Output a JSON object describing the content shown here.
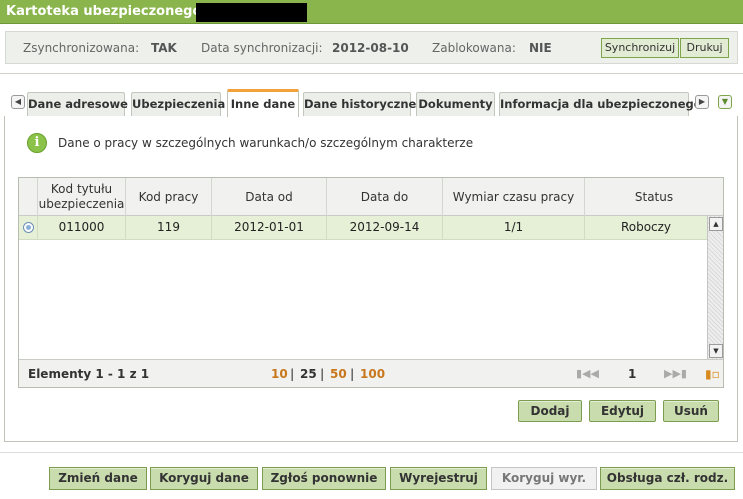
{
  "window": {
    "title": "Kartoteka ubezpieczonego -"
  },
  "sync": {
    "synchronized_label": "Zsynchronizowana:",
    "synchronized_value": "TAK",
    "date_label": "Data synchronizacji:",
    "date_value": "2012-08-10",
    "locked_label": "Zablokowana:",
    "locked_value": "NIE",
    "sync_button": "Synchronizuj",
    "print_button": "Drukuj"
  },
  "tabs": [
    {
      "label": "Dane adresowe"
    },
    {
      "label": "Ubezpieczenia"
    },
    {
      "label": "Inne dane"
    },
    {
      "label": "Dane historyczne"
    },
    {
      "label": "Dokumenty"
    },
    {
      "label": "Informacja dla ubezpieczonego"
    }
  ],
  "active_tab": "Inne dane",
  "info": {
    "text": "Dane o pracy w szczególnych warunkach/o szczególnym charakterze"
  },
  "grid": {
    "columns": [
      "Kod tytułu ubezpieczenia",
      "Kod pracy",
      "Data od",
      "Data do",
      "Wymiar czasu pracy",
      "Status"
    ],
    "rows": [
      {
        "kod_tytulu": "011000",
        "kod_pracy": "119",
        "data_od": "2012-01-01",
        "data_do": "2012-09-14",
        "wymiar": "1/1",
        "status": "Roboczy"
      }
    ],
    "footer": {
      "elements": "Elementy 1 - 1 z 1",
      "page_sizes": [
        "10",
        "25",
        "50",
        "100"
      ],
      "current_page": "1"
    }
  },
  "actions": {
    "add": "Dodaj",
    "edit": "Edytuj",
    "delete": "Usuń"
  },
  "bottom_buttons": {
    "change": "Zmień dane",
    "correct": "Koryguj dane",
    "resubmit": "Zgłoś ponownie",
    "deregister": "Wyrejestruj",
    "correct_deregistration": "Koryguj wyr.",
    "child_support": "Obsługa czł. rodz."
  },
  "colors": {
    "title_bar": "#8ab54d",
    "accent_orange": "#f2a23a",
    "row_highlight": "#e6f0d6",
    "button_green": "#c9dcae",
    "page_size_link": "#c8771c"
  },
  "icons": {
    "info": "info-circle-icon",
    "tab_prev": "arrow-left-icon",
    "tab_next": "arrow-right-icon",
    "tab_menu": "chevron-down-icon"
  }
}
